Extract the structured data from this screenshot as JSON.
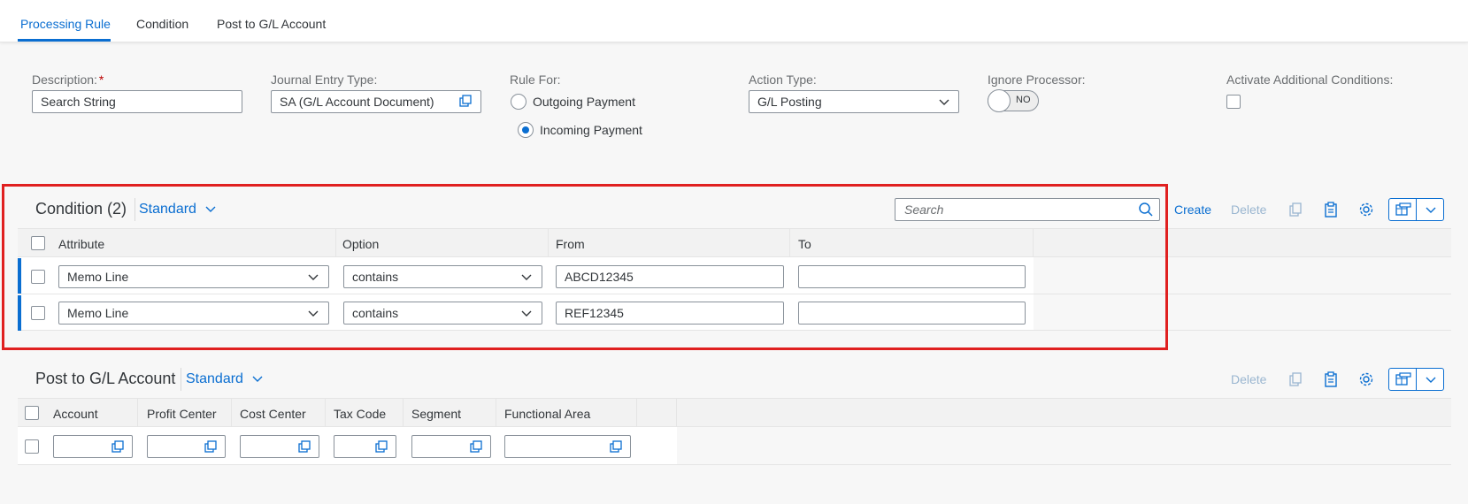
{
  "tabs": [
    {
      "label": "Processing Rule",
      "active": true
    },
    {
      "label": "Condition",
      "active": false
    },
    {
      "label": "Post to G/L Account",
      "active": false
    }
  ],
  "form": {
    "description": {
      "label": "Description:",
      "required_mark": "*",
      "value": "Search String"
    },
    "journal_entry_type": {
      "label": "Journal Entry Type:",
      "value": "SA (G/L Account Document)"
    },
    "rule_for": {
      "label": "Rule For:",
      "options": [
        {
          "label": "Outgoing Payment",
          "selected": false
        },
        {
          "label": "Incoming Payment",
          "selected": true
        }
      ]
    },
    "action_type": {
      "label": "Action Type:",
      "value": "G/L Posting"
    },
    "ignore_processor": {
      "label": "Ignore Processor:",
      "state": "NO"
    },
    "activate_additional_conditions": {
      "label": "Activate Additional Conditions:",
      "checked": false
    }
  },
  "condition_table": {
    "title": "Condition (2)",
    "variant": "Standard",
    "search_placeholder": "Search",
    "create_label": "Create",
    "delete_label": "Delete",
    "columns": [
      "Attribute",
      "Option",
      "From",
      "To"
    ],
    "rows": [
      {
        "attribute": "Memo Line",
        "option": "contains",
        "from": "ABCD12345",
        "to": ""
      },
      {
        "attribute": "Memo Line",
        "option": "contains",
        "from": "REF12345",
        "to": ""
      }
    ]
  },
  "gl_table": {
    "title": "Post to G/L Account",
    "variant": "Standard",
    "delete_label": "Delete",
    "columns": [
      "Account",
      "Profit Center",
      "Cost Center",
      "Tax Code",
      "Segment",
      "Functional Area"
    ]
  },
  "colors": {
    "accent": "#0a6ed1",
    "highlight_frame": "#e02020"
  }
}
